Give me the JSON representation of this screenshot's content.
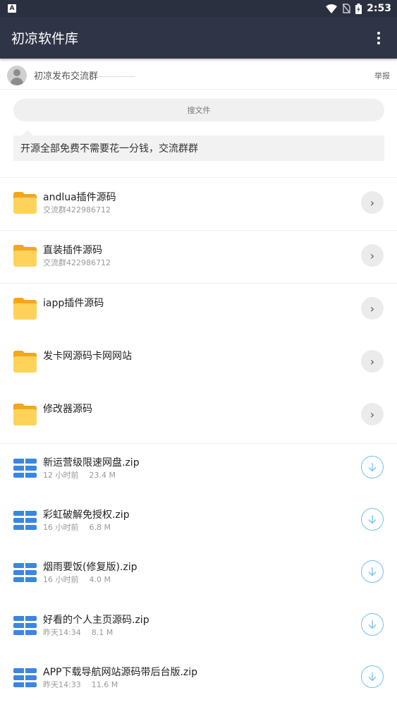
{
  "status_bar": {
    "time": "2:53",
    "app_badge": "A"
  },
  "app_bar": {
    "title": "初凉软件库",
    "menu_icon": "more-vert-icon"
  },
  "group": {
    "name": "初凉发布交流群",
    "report_label": "举报"
  },
  "search": {
    "placeholder": "搜文件"
  },
  "notice": {
    "text": "开源全部免费不需要花一分钱，交流群群"
  },
  "folders": [
    {
      "name": "andlua插件源码",
      "subtitle": "交流群422986712"
    },
    {
      "name": "直装插件源码",
      "subtitle": "交流群422986712"
    },
    {
      "name": "iapp插件源码",
      "subtitle": ""
    },
    {
      "name": "发卡网源码卡网网站",
      "subtitle": ""
    },
    {
      "name": "修改器源码",
      "subtitle": ""
    }
  ],
  "files": [
    {
      "name": "新运营级限速网盘.zip",
      "time": "12 小时前",
      "size": "23.4 M"
    },
    {
      "name": "彩虹破解免授权.zip",
      "time": "16 小时前",
      "size": "6.8 M"
    },
    {
      "name": "烟雨要饭(修复版).zip",
      "time": "16 小时前",
      "size": "4.0 M"
    },
    {
      "name": "好看的个人主页源码.zip",
      "time": "昨天14:34",
      "size": "8.1 M"
    },
    {
      "name": "APP下载导航网站源码带后台版.zip",
      "time": "昨天14:33",
      "size": "11.6 M"
    }
  ]
}
